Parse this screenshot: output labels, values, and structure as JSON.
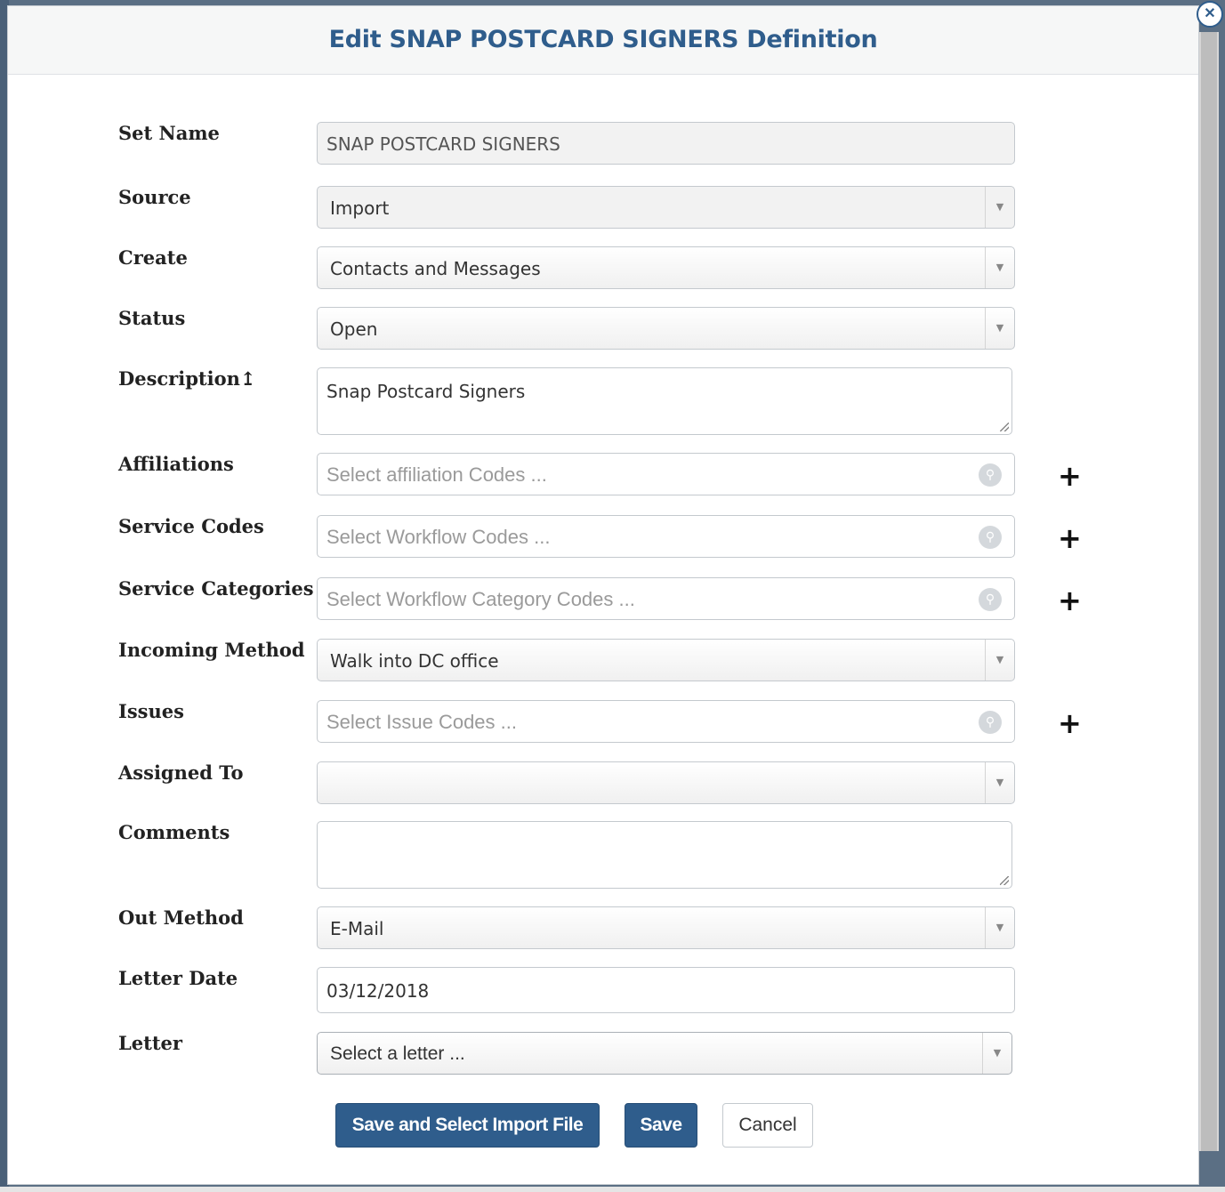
{
  "dialog": {
    "title": "Edit SNAP POSTCARD SIGNERS Definition",
    "close_icon": "close-icon"
  },
  "form": {
    "set_name": {
      "label": "Set Name",
      "value": "SNAP POSTCARD SIGNERS"
    },
    "source": {
      "label": "Source",
      "value": "Import"
    },
    "create": {
      "label": "Create",
      "value": "Contacts and Messages"
    },
    "status": {
      "label": "Status",
      "value": "Open"
    },
    "description": {
      "label": "Description↥",
      "value": "Snap Postcard Signers"
    },
    "affiliations": {
      "label": "Affiliations",
      "placeholder": "Select affiliation Codes ..."
    },
    "service_codes": {
      "label": "Service Codes",
      "placeholder": "Select Workflow Codes ..."
    },
    "service_categories": {
      "label": "Service Categories",
      "placeholder": "Select Workflow Category Codes ..."
    },
    "incoming_method": {
      "label": "Incoming Method",
      "value": "Walk into DC office"
    },
    "issues": {
      "label": "Issues",
      "placeholder": "Select Issue Codes ..."
    },
    "assigned_to": {
      "label": "Assigned To",
      "value": ""
    },
    "comments": {
      "label": "Comments",
      "value": ""
    },
    "out_method": {
      "label": "Out Method",
      "value": "E-Mail"
    },
    "letter_date": {
      "label": "Letter Date",
      "value": "03/12/2018"
    },
    "letter": {
      "label": "Letter",
      "placeholder": "Select a letter ..."
    }
  },
  "plus_symbol": "+",
  "buttons": {
    "save_import": "Save and Select Import File",
    "save": "Save",
    "cancel": "Cancel"
  },
  "colors": {
    "primary": "#2f5d8c",
    "title": "#2f5d8c"
  }
}
